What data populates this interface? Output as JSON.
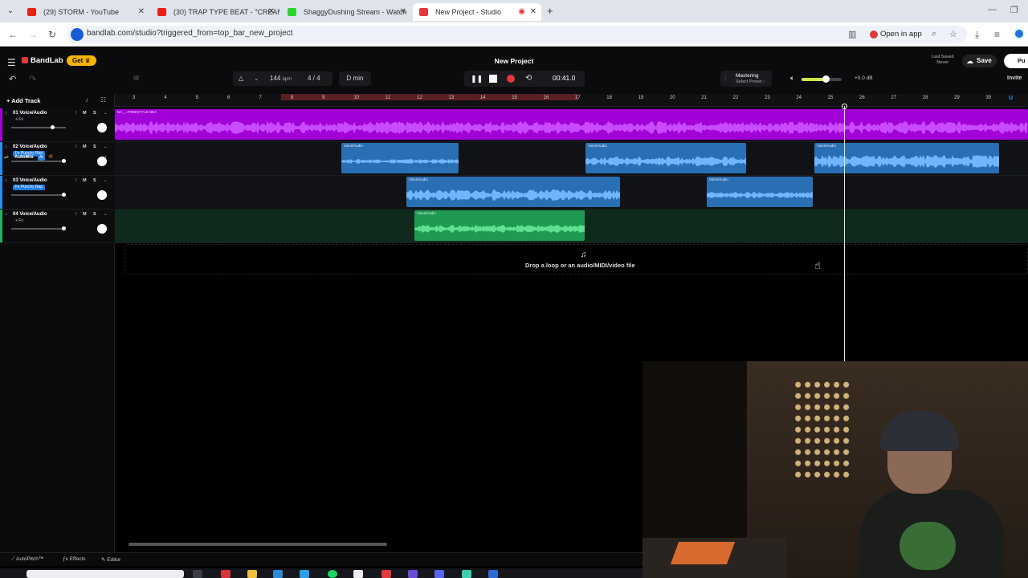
{
  "browser": {
    "tabs": [
      {
        "title": "(29) STORM - YouTube",
        "favicon_color": "#e62117"
      },
      {
        "title": "(30) TRAP TYPE BEAT - \"CREAM\"",
        "favicon_color": "#e62117"
      },
      {
        "title": "ShaggyDushing Stream - Watch",
        "favicon_color": "#2cd32c"
      },
      {
        "title": "New Project - Studio",
        "favicon_color": "#e2383b"
      }
    ],
    "url": "bandlab.com/studio?triggered_from=top_bar_new_project",
    "open_in_app": "Open in app"
  },
  "app": {
    "logo": "BandLab",
    "get_button": "Get ♛",
    "project_title": "New Project",
    "last_saved_label": "Last Saved",
    "last_saved_value": "Never",
    "save": "Save",
    "publish": "Pu",
    "invite": "Invite",
    "bpm": "144",
    "bpm_unit": "bpm",
    "time_signature": "4 / 4",
    "key": "D min",
    "time": "00:41.0",
    "mastering_title": "Mastering",
    "mastering_sub": "Select Preset ›",
    "volume_db": "+0.0 dB",
    "volume_level": 0.6,
    "accent_color": "#f5b40c",
    "record_color": "#e2383b"
  },
  "tracks": {
    "add_track": "Add Track",
    "items": [
      {
        "name": "01  Voice/Audio",
        "fx": "+ Fx",
        "fx_is_tag": false,
        "color": "#a100d6",
        "volume": 0.75
      },
      {
        "name": "02  Voice/Audio",
        "fx": "Fx Punchy Rap",
        "fx_is_tag": true,
        "color": "#2b8ff0",
        "volume": 0.95
      },
      {
        "name": "03  Voice/Audio",
        "fx": "Fx Punchy Rap",
        "fx_is_tag": true,
        "color": "#2b8ff0",
        "volume": 0.95
      },
      {
        "name": "04  Voice/Audio",
        "fx": "+ Fx",
        "fx_is_tag": false,
        "color": "#22b060",
        "volume": 0.95
      }
    ],
    "mute": "M",
    "solo": "S",
    "automix": "AutoMix",
    "ai": "AI"
  },
  "timeline": {
    "ruler_labels": [
      "3",
      "4",
      "5",
      "6",
      "7",
      "8",
      "9",
      "10",
      "11",
      "12",
      "13",
      "14",
      "15",
      "16",
      "17",
      "18",
      "19",
      "20",
      "21",
      "22",
      "23",
      "24",
      "25",
      "26",
      "27",
      "28",
      "29",
      "30"
    ],
    "clip_label_1": "NA_...FREESTYLE BEA",
    "clip_label": "Voice/Audio",
    "drop_text": "Drop a loop or an audio/MIDI/video file"
  },
  "bottom": {
    "autopitch": "AutoPitch™",
    "effects": "Effects",
    "editor": "Editor"
  }
}
